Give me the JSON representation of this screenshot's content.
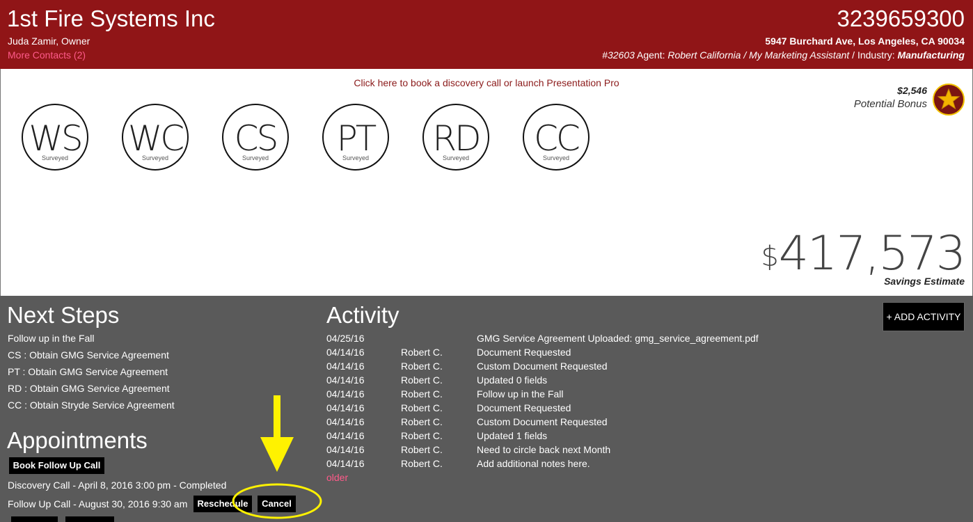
{
  "header": {
    "company": "1st Fire Systems Inc",
    "owner": "Juda Zamir, Owner",
    "more_contacts": "More Contacts (2)",
    "phone": "3239659300",
    "address": "5947 Burchard Ave, Los Angeles, CA 90034",
    "agent_id": "#32603",
    "agent_label": " Agent: ",
    "agent": "Robert California / My Marketing Assistant",
    "industry_label": " / Industry: ",
    "industry": "Manufacturing"
  },
  "top": {
    "book_link": "Click here to book a discovery call or launch Presentation Pro",
    "bonus_amount": "$2,546",
    "bonus_label": "Potential Bonus",
    "savings_currency": "$",
    "savings_amount": "417,573",
    "savings_label": "Savings Estimate"
  },
  "surveys": [
    {
      "abbr": "WS",
      "status": "Surveyed"
    },
    {
      "abbr": "WC",
      "status": "Surveyed"
    },
    {
      "abbr": "CS",
      "status": "Surveyed"
    },
    {
      "abbr": "PT",
      "status": "Surveyed"
    },
    {
      "abbr": "RD",
      "status": "Surveyed"
    },
    {
      "abbr": "CC",
      "status": "Surveyed"
    }
  ],
  "next_steps": {
    "title": "Next Steps",
    "items": [
      "Follow up in the Fall",
      "CS : Obtain GMG Service Agreement",
      "PT : Obtain GMG Service Agreement",
      "RD : Obtain GMG Service Agreement",
      "CC : Obtain Stryde Service Agreement"
    ]
  },
  "appointments": {
    "title": "Appointments",
    "book_button": "Book Follow Up Call",
    "items": [
      "Discovery Call - April 8, 2016 3:00 pm - Completed",
      "Follow Up Call - August 30, 2016 9:30 am"
    ],
    "reschedule": "Reschedule",
    "cancel": "Cancel"
  },
  "activity": {
    "title": "Activity",
    "add_button": "+ ADD ACTIVITY",
    "older": "older",
    "rows": [
      {
        "date": "04/25/16",
        "who": "",
        "desc": "GMG Service Agreement Uploaded: gmg_service_agreement.pdf"
      },
      {
        "date": "04/14/16",
        "who": "Robert C.",
        "desc": "Document Requested"
      },
      {
        "date": "04/14/16",
        "who": "Robert C.",
        "desc": "Custom Document Requested"
      },
      {
        "date": "04/14/16",
        "who": "Robert C.",
        "desc": "Updated 0 fields"
      },
      {
        "date": "04/14/16",
        "who": "Robert C.",
        "desc": "Follow up in the Fall"
      },
      {
        "date": "04/14/16",
        "who": "Robert C.",
        "desc": "Document Requested"
      },
      {
        "date": "04/14/16",
        "who": "Robert C.",
        "desc": "Custom Document Requested"
      },
      {
        "date": "04/14/16",
        "who": "Robert C.",
        "desc": "Updated 1 fields"
      },
      {
        "date": "04/14/16",
        "who": "Robert C.",
        "desc": "Need to circle back next Month"
      },
      {
        "date": "04/14/16",
        "who": "Robert C.",
        "desc": "Add additional notes here."
      }
    ]
  },
  "colors": {
    "header_bg": "#901517",
    "panel_bg": "#5a5a5a",
    "link_pink": "#ff5a8a",
    "annotation_yellow": "#fff200"
  }
}
